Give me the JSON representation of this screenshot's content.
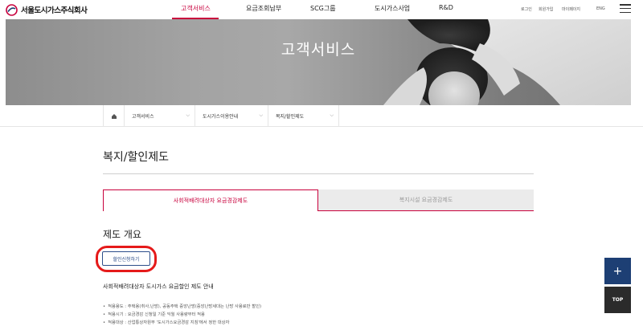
{
  "header": {
    "logo_text": "서울도시가스주식회사",
    "nav": [
      "고객서비스",
      "요금조회납부",
      "SCG그룹",
      "도시가스사업",
      "R&D"
    ],
    "util": [
      "로그인",
      "회원가입",
      "마이페이지",
      "ENG"
    ]
  },
  "hero": {
    "title": "고객서비스"
  },
  "breadcrumb": {
    "items": [
      "고객서비스",
      "도시가스이용안내",
      "복지/할인제도"
    ]
  },
  "main": {
    "page_title": "복지/할인제도",
    "tabs": [
      "사회적배려대상자 요금경감제도",
      "복지시설 요금경감제도"
    ],
    "section_title": "제도 개요",
    "apply_button": "할인신청하기",
    "info_title": "사회적배려대상자 도시가스 요금할인 제도 안내",
    "info_items": [
      "적용용도 : 주택용(취사,난방), 공동주택 중앙난방(중앙난방세대는 난방 사용료만 할인)",
      "적용시기 : 요금경감 신청일 기준 익월 사용량부터 적용",
      "적용대상 : 산업통상자원부 '도시가스요금경감 지침'에서 정한 대상자"
    ]
  },
  "floating": {
    "plus": "+",
    "top": "TOP"
  },
  "colors": {
    "accent": "#c8003c",
    "navy": "#1d3f74",
    "highlight_ring": "#e51a1a"
  },
  "icons": [
    "logo-mark-icon",
    "home-icon",
    "chevron-down-icon",
    "hamburger-menu-icon",
    "plus-icon"
  ]
}
